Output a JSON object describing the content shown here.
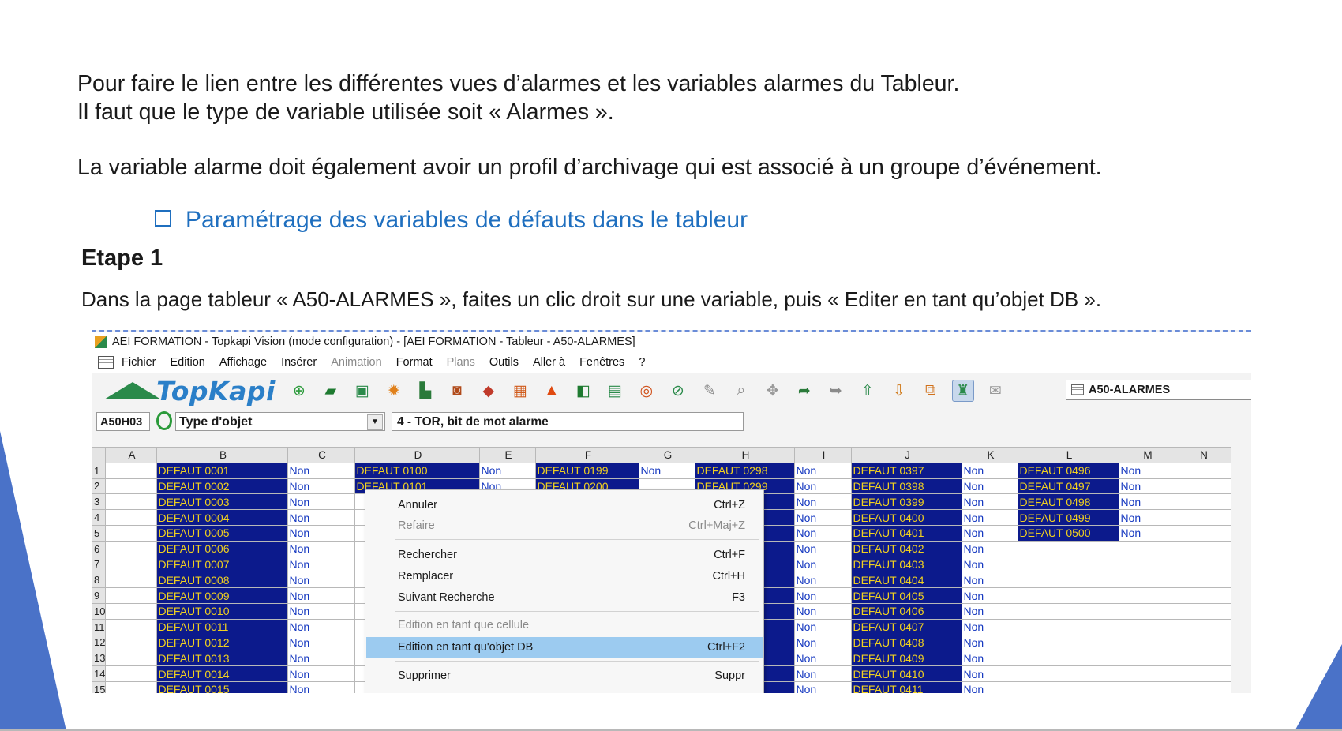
{
  "slide": {
    "intro_line1": "Pour faire le lien entre les différentes vues d’alarmes et les variables alarmes du Tableur.",
    "intro_line2": "Il faut que le type de variable utilisée soit « Alarmes ».",
    "paragraph2": "La variable alarme doit  également avoir un profil d’archivage qui est associé à un groupe d’événement.",
    "bullet": "Paramétrage des variables de défauts dans le tableur",
    "step_title": "Etape 1",
    "step_desc": "Dans la page tableur « A50-ALARMES », faites un clic droit sur une variable, puis  « Editer en tant qu’objet DB »."
  },
  "app": {
    "title": "AEI FORMATION - Topkapi Vision (mode configuration) - [AEI FORMATION - Tableur - A50-ALARMES]",
    "menu": [
      "Fichier",
      "Edition",
      "Affichage",
      "Insérer",
      "Animation",
      "Format",
      "Plans",
      "Outils",
      "Aller à",
      "Fenêtres",
      "?"
    ],
    "logo_text": "TopKapi",
    "toolbar_icons": [
      "new-icon",
      "open-folder-icon",
      "save-icon",
      "settings-gear-icon",
      "printer-icon",
      "camera-icon",
      "shapes-icon",
      "table-icon",
      "alarm-triangle-icon",
      "truck-icon",
      "calculator-icon",
      "target-icon",
      "compass-icon",
      "pen-icon",
      "zoom-icon",
      "pointer-icon",
      "export-icon",
      "import-icon",
      "move-up-icon",
      "move-down-icon",
      "copy-icon",
      "user-lock-icon",
      "mail-icon"
    ],
    "page_select": "A50-ALARMES",
    "cell_ref": "A50H03",
    "object_status": "O",
    "type_label": "Type d'objet",
    "type_value": "4 - TOR, bit de mot alarme"
  },
  "sheet": {
    "columns": [
      "A",
      "B",
      "C",
      "D",
      "E",
      "F",
      "G",
      "H",
      "I",
      "J",
      "K",
      "L",
      "M",
      "N"
    ],
    "rows": [
      {
        "n": "1",
        "B": "DEFAUT 0001",
        "C": "Non",
        "D": "DEFAUT 0100",
        "E": "Non",
        "F": "DEFAUT 0199",
        "G": "Non",
        "H": "DEFAUT 0298",
        "I": "Non",
        "J": "DEFAUT 0397",
        "K": "Non",
        "L": "DEFAUT 0496",
        "M": "Non"
      },
      {
        "n": "2",
        "B": "DEFAUT 0002",
        "C": "Non",
        "D": "DEFAUT 0101",
        "E": "Non",
        "F": "DEFAUT 0200",
        "G": "",
        "H": "DEFAUT 0299",
        "I": "Non",
        "J": "DEFAUT 0398",
        "K": "Non",
        "L": "DEFAUT 0497",
        "M": "Non"
      },
      {
        "n": "3",
        "B": "DEFAUT 0003",
        "C": "Non",
        "H": "00",
        "I": "Non",
        "J": "DEFAUT 0399",
        "K": "Non",
        "L": "DEFAUT 0498",
        "M": "Non"
      },
      {
        "n": "4",
        "B": "DEFAUT 0004",
        "C": "Non",
        "H": "01",
        "I": "Non",
        "J": "DEFAUT 0400",
        "K": "Non",
        "L": "DEFAUT 0499",
        "M": "Non"
      },
      {
        "n": "5",
        "B": "DEFAUT 0005",
        "C": "Non",
        "H": "02",
        "I": "Non",
        "J": "DEFAUT 0401",
        "K": "Non",
        "L": "DEFAUT 0500",
        "M": "Non"
      },
      {
        "n": "6",
        "B": "DEFAUT 0006",
        "C": "Non",
        "H": "03",
        "I": "Non",
        "J": "DEFAUT 0402",
        "K": "Non"
      },
      {
        "n": "7",
        "B": "DEFAUT 0007",
        "C": "Non",
        "H": "04",
        "I": "Non",
        "J": "DEFAUT 0403",
        "K": "Non"
      },
      {
        "n": "8",
        "B": "DEFAUT 0008",
        "C": "Non",
        "H": "05",
        "I": "Non",
        "J": "DEFAUT 0404",
        "K": "Non"
      },
      {
        "n": "9",
        "B": "DEFAUT 0009",
        "C": "Non",
        "H": "06",
        "I": "Non",
        "J": "DEFAUT 0405",
        "K": "Non"
      },
      {
        "n": "10",
        "B": "DEFAUT 0010",
        "C": "Non",
        "H": "07",
        "I": "Non",
        "J": "DEFAUT 0406",
        "K": "Non"
      },
      {
        "n": "11",
        "B": "DEFAUT 0011",
        "C": "Non",
        "H": "08",
        "I": "Non",
        "J": "DEFAUT 0407",
        "K": "Non"
      },
      {
        "n": "12",
        "B": "DEFAUT 0012",
        "C": "Non",
        "H": "09",
        "I": "Non",
        "J": "DEFAUT 0408",
        "K": "Non"
      },
      {
        "n": "13",
        "B": "DEFAUT 0013",
        "C": "Non",
        "H": "10",
        "I": "Non",
        "J": "DEFAUT 0409",
        "K": "Non"
      },
      {
        "n": "14",
        "B": "DEFAUT 0014",
        "C": "Non",
        "H": "11",
        "I": "Non",
        "J": "DEFAUT 0410",
        "K": "Non"
      },
      {
        "n": "15",
        "B": "DEFAUT 0015",
        "C": "Non",
        "H": "12",
        "I": "Non",
        "J": "DEFAUT 0411",
        "K": "Non"
      }
    ]
  },
  "context_menu": {
    "undo": {
      "label": "Annuler",
      "shortcut": "Ctrl+Z"
    },
    "redo": {
      "label": "Refaire",
      "shortcut": "Ctrl+Maj+Z"
    },
    "find": {
      "label": "Rechercher",
      "shortcut": "Ctrl+F"
    },
    "replace": {
      "label": "Remplacer",
      "shortcut": "Ctrl+H"
    },
    "find_next": {
      "label": "Suivant Recherche",
      "shortcut": "F3"
    },
    "edit_cell": {
      "label": "Edition en tant que cellule",
      "shortcut": ""
    },
    "edit_db": {
      "label": "Edition en tant qu'objet DB",
      "shortcut": "Ctrl+F2"
    },
    "delete": {
      "label": "Supprimer",
      "shortcut": "Suppr"
    }
  },
  "colors": {
    "accent": "#4a72c8",
    "link_blue": "#1f6fbf",
    "cell_navy": "#0c1a8c",
    "cell_text_yellow": "#f0d020",
    "highlight": "#9ccbf0"
  }
}
